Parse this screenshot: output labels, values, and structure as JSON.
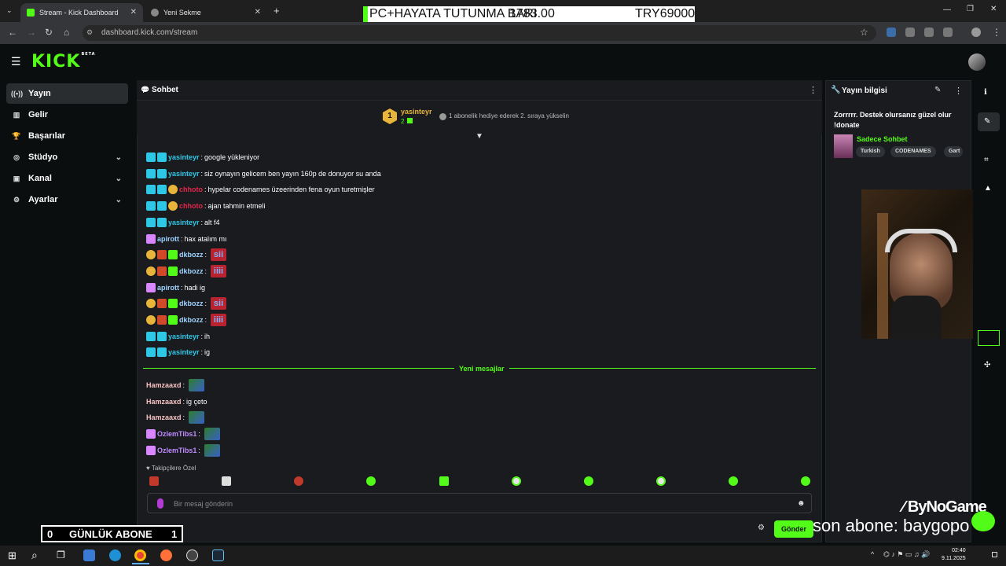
{
  "browser": {
    "tabs": [
      {
        "title": "Stream - Kick Dashboard",
        "active": true
      },
      {
        "title": "Yeni Sekme",
        "active": false
      }
    ],
    "url": "dashboard.kick.com/stream"
  },
  "banner": {
    "left": "PC+HAYATA TUTUNMA BARI",
    "mid": "1783.00",
    "right": "TRY69000"
  },
  "logo": {
    "text": "KICK",
    "badge": "BETA"
  },
  "sidebar": {
    "items": [
      {
        "label": "Yayın",
        "icon": "broadcast-icon",
        "active": true,
        "expandable": false
      },
      {
        "label": "Gelir",
        "icon": "revenue-icon",
        "active": false,
        "expandable": false
      },
      {
        "label": "Başarılar",
        "icon": "trophy-icon",
        "active": false,
        "expandable": false
      },
      {
        "label": "Stüdyo",
        "icon": "studio-icon",
        "active": false,
        "expandable": true
      },
      {
        "label": "Kanal",
        "icon": "channel-icon",
        "active": false,
        "expandable": true
      },
      {
        "label": "Ayarlar",
        "icon": "gear-icon",
        "active": false,
        "expandable": true
      }
    ]
  },
  "chat": {
    "title": "Sohbet",
    "pinned": {
      "rank": "1",
      "user": "yasinteyr",
      "count": "2",
      "note": "1 abonelik hediye ederek 2. sıraya yükselin"
    },
    "messages": [
      {
        "user": "yasinteyr",
        "color": "#2ec7e6",
        "text": "google yükleniyor"
      },
      {
        "user": "yasinteyr",
        "color": "#2ec7e6",
        "text": "siz oynayın gelicem ben yayın 160p de donuyor su anda"
      },
      {
        "user": "chhoto",
        "color": "#e3264b",
        "text": "hypelar codenames üzeerinden fena oyun turetmişler"
      },
      {
        "user": "chhoto",
        "color": "#e3264b",
        "text": "ajan tahmin etmeli"
      },
      {
        "user": "yasinteyr",
        "color": "#2ec7e6",
        "text": "alt f4"
      },
      {
        "user": "apirott",
        "color": "#9fd3ff",
        "text": "hax atalım mı"
      },
      {
        "user": "dkbozz",
        "color": "#9fd3ff",
        "text": "",
        "emote": "sii"
      },
      {
        "user": "dkbozz",
        "color": "#9fd3ff",
        "text": "",
        "emote": "iiii"
      },
      {
        "user": "apirott",
        "color": "#9fd3ff",
        "text": "hadi ig"
      },
      {
        "user": "dkbozz",
        "color": "#9fd3ff",
        "text": "",
        "emote": "sii"
      },
      {
        "user": "dkbozz",
        "color": "#9fd3ff",
        "text": "",
        "emote": "iiii"
      },
      {
        "user": "yasinteyr",
        "color": "#2ec7e6",
        "text": "ih"
      },
      {
        "user": "yasinteyr",
        "color": "#2ec7e6",
        "text": "ig"
      }
    ],
    "new_messages_label": "Yeni mesajlar",
    "new_messages": [
      {
        "user": "Hamzaaxd",
        "color": "#f7c3c3",
        "text": ""
      },
      {
        "user": "Hamzaaxd",
        "color": "#f7c3c3",
        "text": "ig çeto"
      },
      {
        "user": "Hamzaaxd",
        "color": "#f7c3c3",
        "text": ""
      },
      {
        "user": "OzlemTibs1",
        "color": "#c08bff",
        "text": ""
      },
      {
        "user": "OzlemTibs1",
        "color": "#c08bff",
        "text": ""
      }
    ],
    "followers_label": "Takipçilere Özel",
    "input_placeholder": "Bir mesaj gönderin",
    "send_label": "Gönder"
  },
  "info": {
    "title": "Yayın bilgisi",
    "stream_title": "Zorrrrr. Destek olursanız güzel olur !donate",
    "category": "Sadece Sohbet",
    "tags": [
      "Turkish",
      "CODENAMES",
      "Gart"
    ]
  },
  "overlay": {
    "sub_left": "0",
    "sub_label": "GÜNLÜK ABONE",
    "sub_right": "1",
    "last_sub": "son abone: baygopo",
    "brand": "ByNoGame"
  },
  "clock": {
    "time": "02:40",
    "date": "9.11.2025"
  },
  "colors": {
    "accent": "#53fc18",
    "panel": "#191b1f",
    "bg": "#0b0e0f"
  }
}
